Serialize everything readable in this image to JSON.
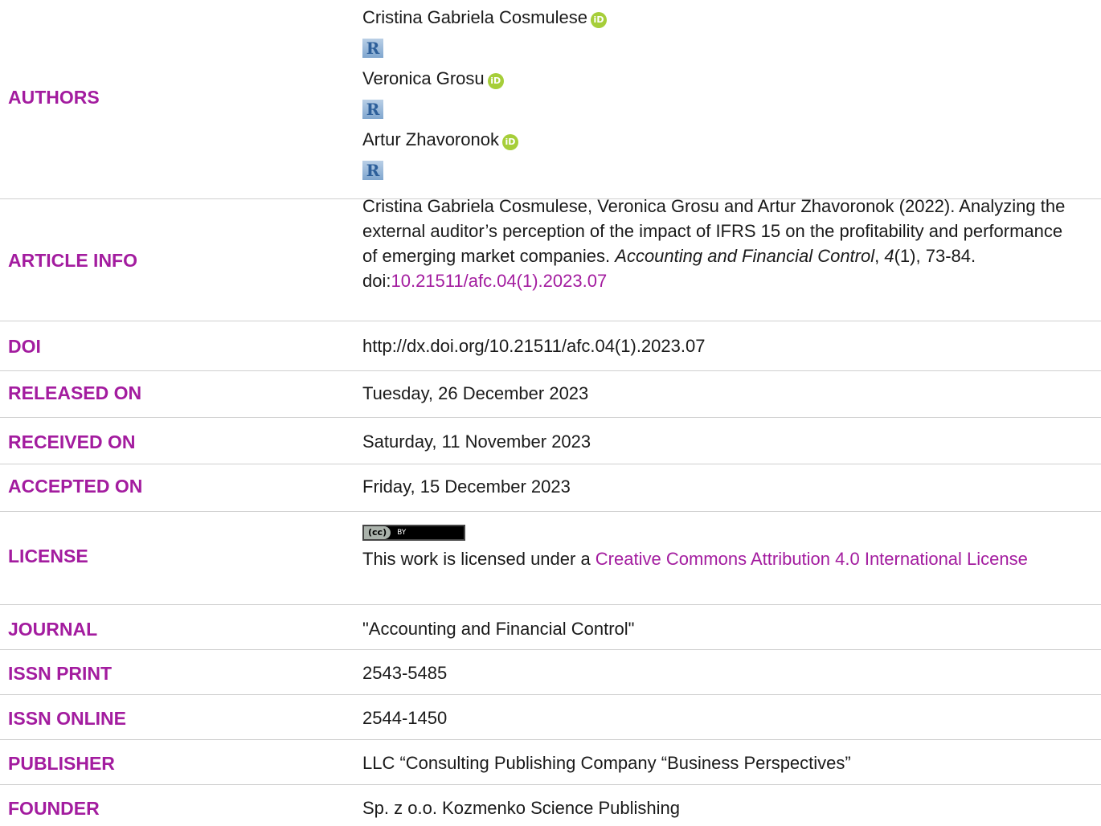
{
  "authors": {
    "label": "AUTHORS",
    "items": [
      {
        "name": "Cristina Gabriela Cosmulese",
        "orcid": "iD",
        "rg": "R"
      },
      {
        "name": "Veronica Grosu",
        "orcid": "iD",
        "rg": "R"
      },
      {
        "name": "Artur Zhavoronok",
        "orcid": "iD",
        "rg": "R"
      }
    ]
  },
  "article_info": {
    "label": "ARTICLE INFO",
    "text_before": "Cristina Gabriela Cosmulese, Veronica Grosu and Artur Zhavoronok (2022). Analyzing the external auditor’s perception of the impact of IFRS 15 on the profitability and performance of emerging market companies. ",
    "journal_italic": "Accounting and Financial Control",
    "sep": ", ",
    "volume_italic": "4",
    "text_after": "(1), 73-84. doi:",
    "doi_link": "10.21511/afc.04(1).2023.07"
  },
  "doi": {
    "label": "DOI",
    "value": "http://dx.doi.org/10.21511/afc.04(1).2023.07"
  },
  "released_on": {
    "label": "RELEASED ON",
    "value": "Tuesday, 26 December 2023"
  },
  "received_on": {
    "label": "RECEIVED ON",
    "value": "Saturday, 11 November 2023"
  },
  "accepted_on": {
    "label": "ACCEPTED ON",
    "value": "Friday, 15 December 2023"
  },
  "license": {
    "label": "LICENSE",
    "badge_left": "(cc)",
    "badge_right": "BY",
    "text": "This work is licensed under a ",
    "link": "Creative Commons Attribution 4.0 International License"
  },
  "journal": {
    "label": "JOURNAL",
    "value": "\"Accounting and Financial Control\""
  },
  "issn_print": {
    "label": "ISSN PRINT",
    "value": "2543-5485"
  },
  "issn_online": {
    "label": "ISSN ONLINE",
    "value": "2544-1450"
  },
  "publisher": {
    "label": "PUBLISHER",
    "value": "LLC “Consulting Publishing Company “Business Perspectives”"
  },
  "founder": {
    "label": "FOUNDER",
    "value": "Sp. z o.o. Kozmenko Science Publishing"
  },
  "colors": {
    "accent": "#a31c9f",
    "orcid": "#a6ce39",
    "divider": "#cfcfcf"
  }
}
